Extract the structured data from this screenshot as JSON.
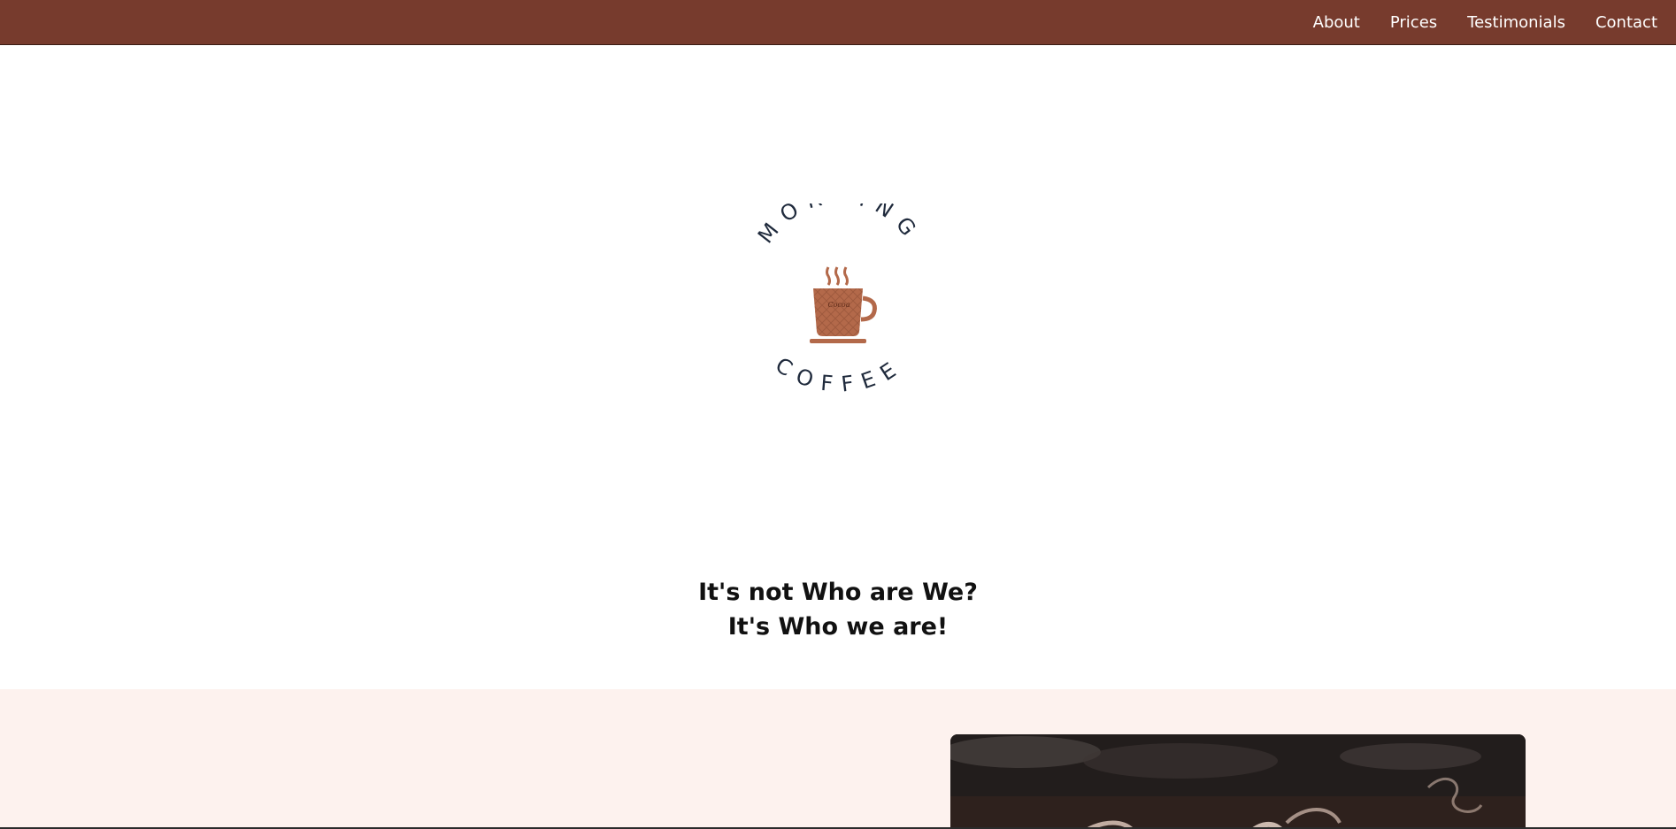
{
  "header": {
    "background_color": "#773b2d",
    "nav": [
      {
        "label": "About"
      },
      {
        "label": "Prices"
      },
      {
        "label": "Testimonials"
      },
      {
        "label": "Contact"
      }
    ]
  },
  "logo": {
    "top_text": "MORNING",
    "bottom_text": "COFFEE",
    "cup_label": "Cocoa",
    "text_color": "#1f2a3c",
    "cup_color": "#b3694a",
    "icon": "coffee-cup-icon"
  },
  "hero": {
    "line1": "It's not Who are We?",
    "line2": "It's Who we are!"
  },
  "about": {
    "background_color": "#fdf2ee",
    "image": "coffee-smoke-photo"
  }
}
